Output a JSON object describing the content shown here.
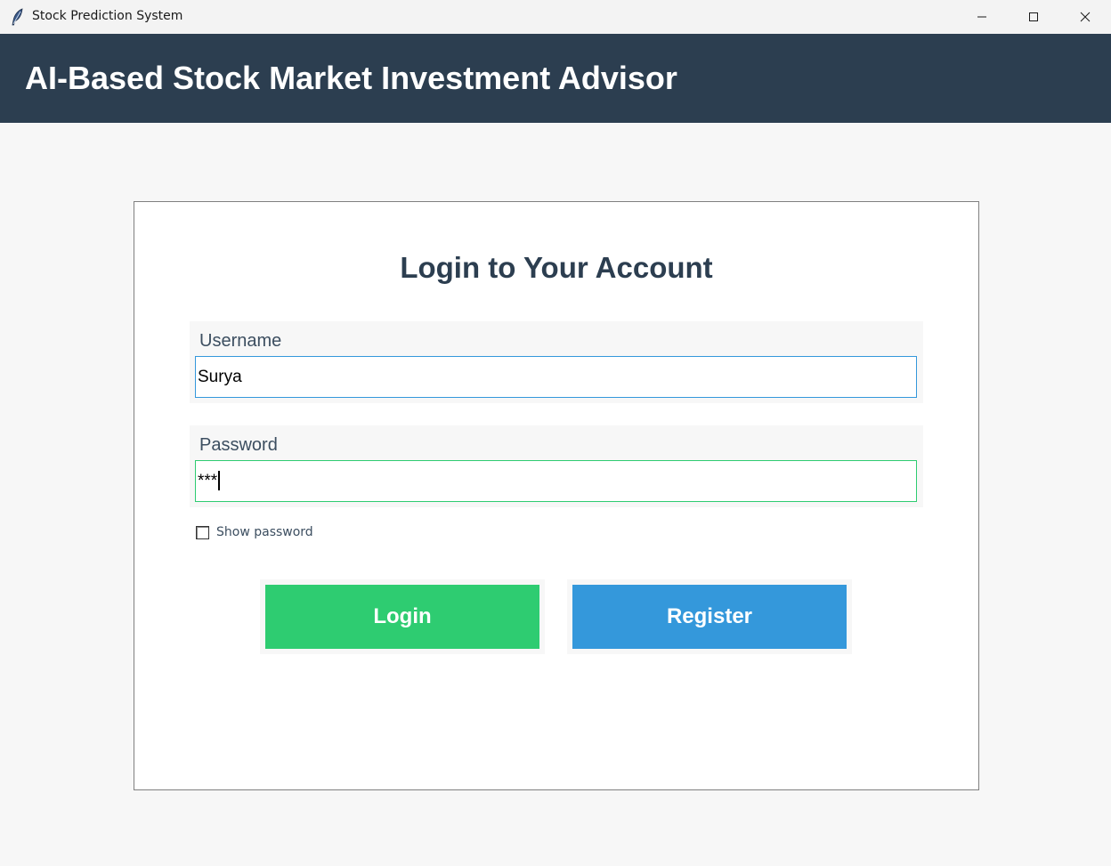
{
  "window": {
    "title": "Stock Prediction System",
    "icon": "feather-icon"
  },
  "header": {
    "title": "AI-Based Stock Market Investment Advisor",
    "background": "#2c3e50"
  },
  "login": {
    "title": "Login to Your Account",
    "username": {
      "label": "Username",
      "value": "Surya"
    },
    "password": {
      "label": "Password",
      "value": "***"
    },
    "show_password_label": "Show password",
    "login_button": "Login",
    "register_button": "Register"
  },
  "colors": {
    "login_button": "#2ecc71",
    "register_button": "#3498db",
    "header": "#2c3e50"
  }
}
